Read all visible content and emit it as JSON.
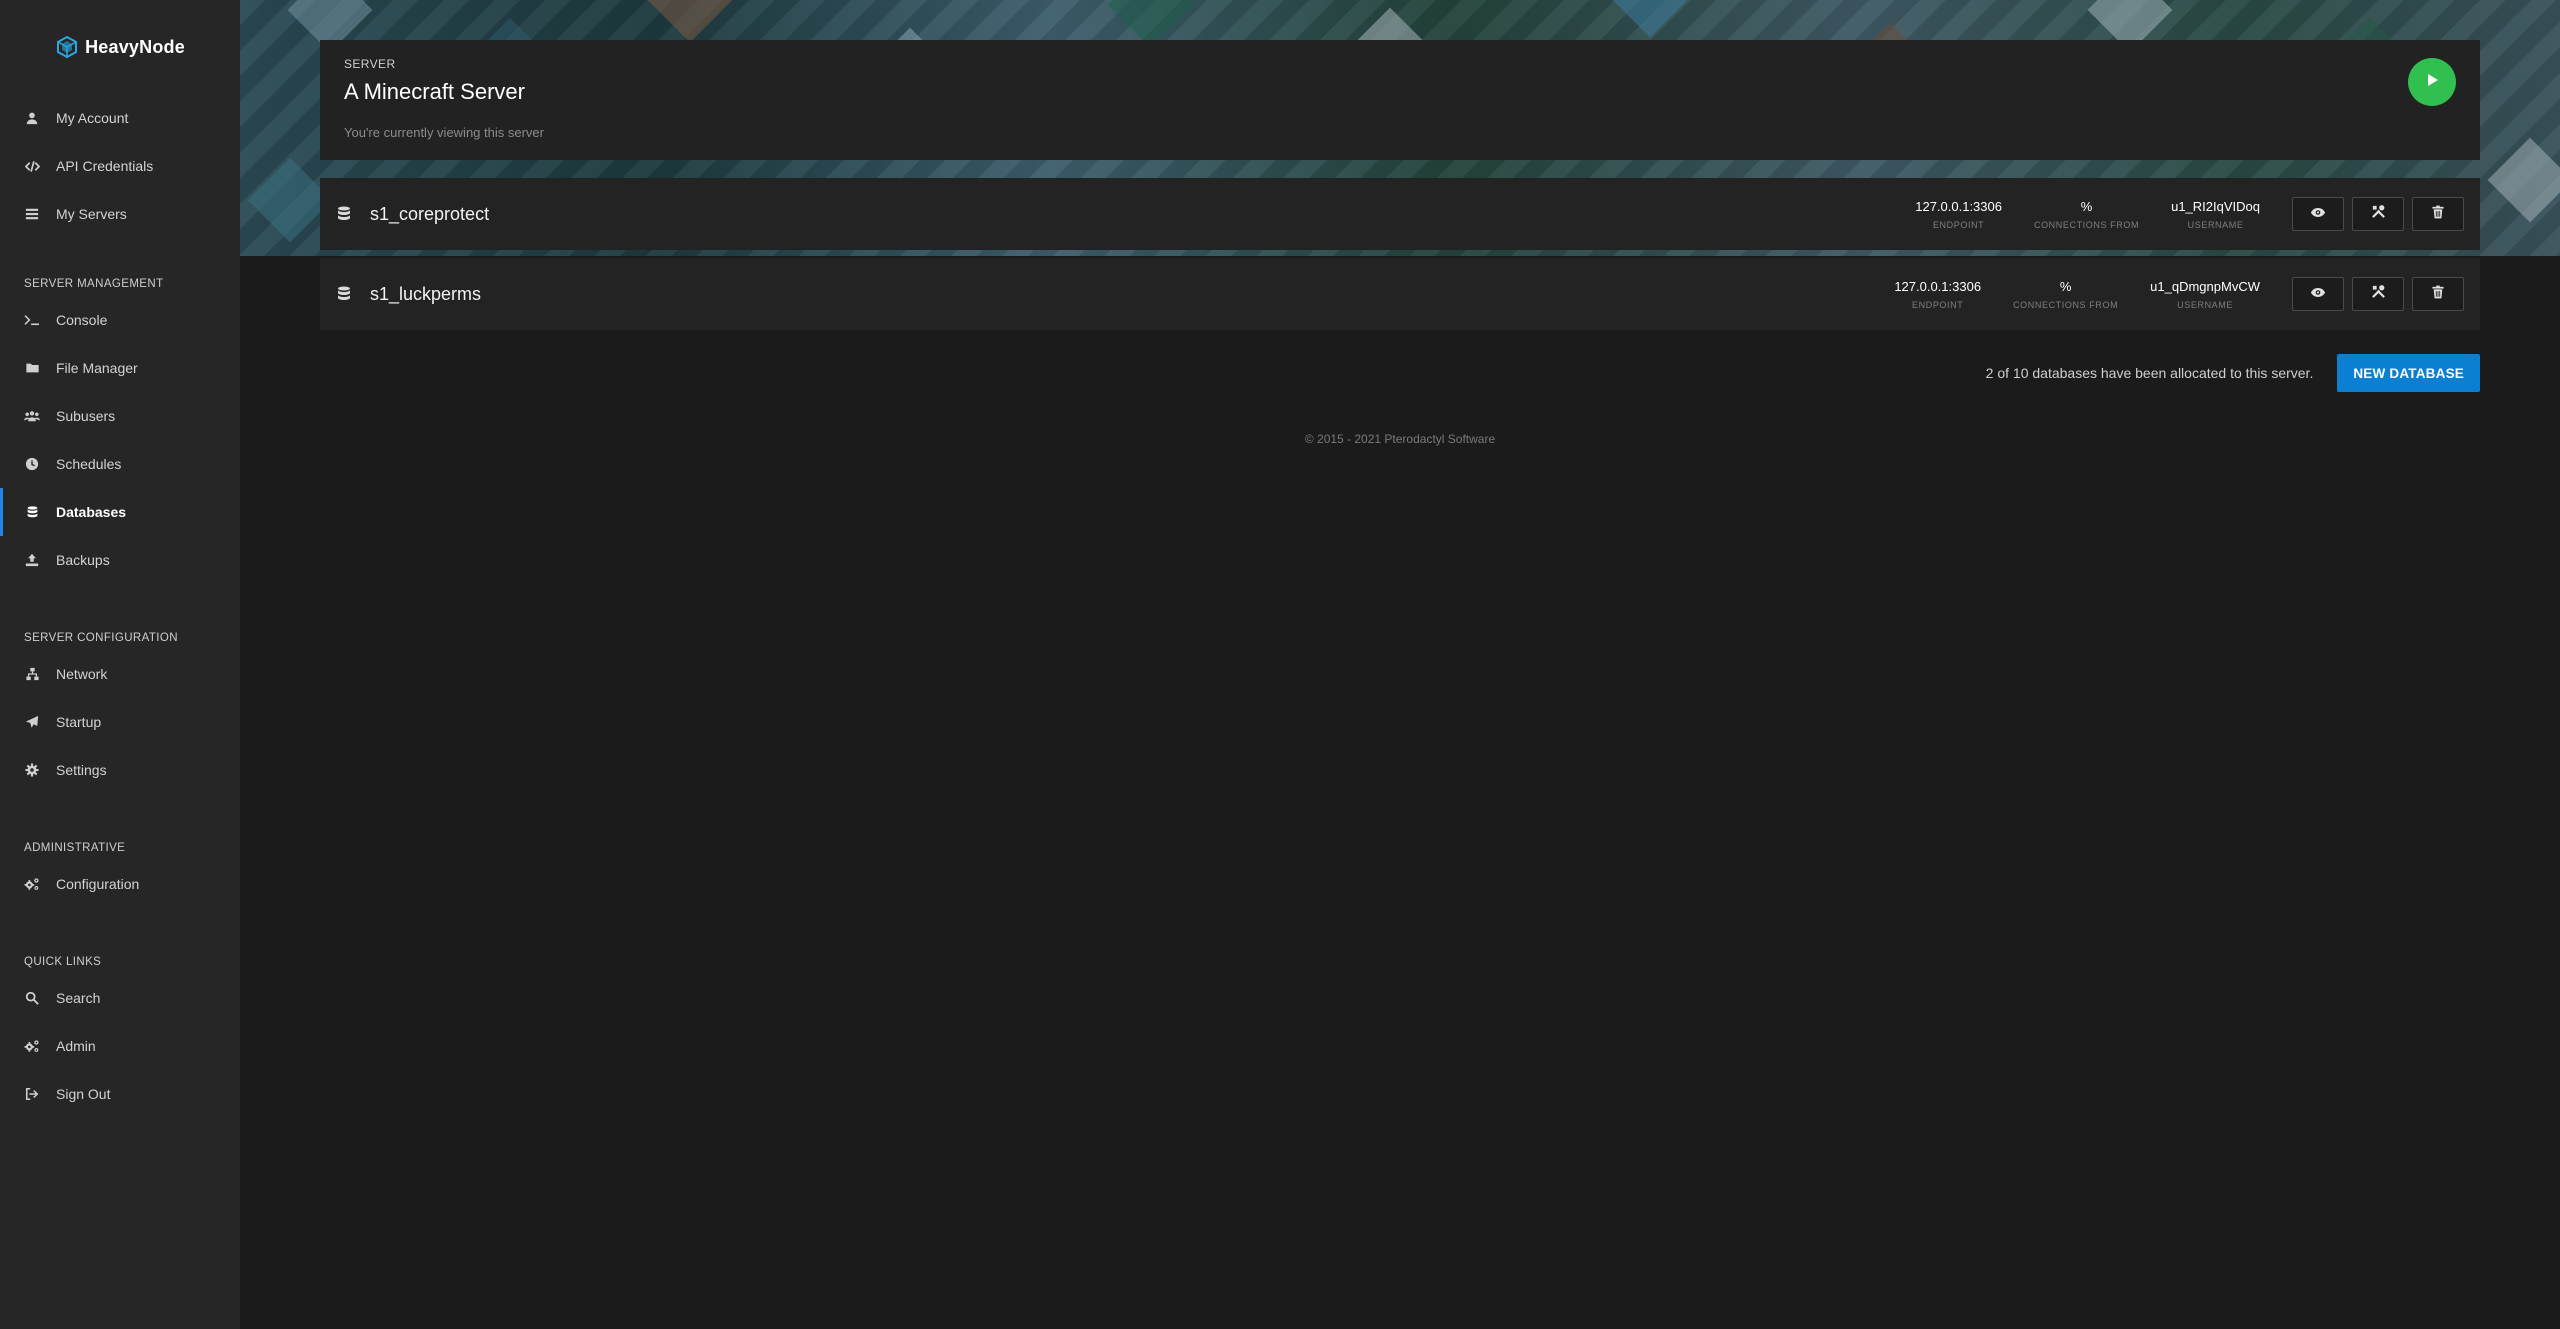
{
  "brand": {
    "name": "HeavyNode"
  },
  "sidebar": {
    "account": [
      {
        "label": "My Account",
        "icon": "user-icon"
      },
      {
        "label": "API Credentials",
        "icon": "code-icon"
      },
      {
        "label": "My Servers",
        "icon": "list-icon"
      }
    ],
    "server_management": {
      "title": "SERVER MANAGEMENT",
      "items": [
        {
          "label": "Console",
          "icon": "terminal-icon"
        },
        {
          "label": "File Manager",
          "icon": "folder-icon"
        },
        {
          "label": "Subusers",
          "icon": "users-icon"
        },
        {
          "label": "Schedules",
          "icon": "clock-icon"
        },
        {
          "label": "Databases",
          "icon": "database-icon",
          "active": true
        },
        {
          "label": "Backups",
          "icon": "upload-icon"
        }
      ]
    },
    "server_configuration": {
      "title": "SERVER CONFIGURATION",
      "items": [
        {
          "label": "Network",
          "icon": "network-icon"
        },
        {
          "label": "Startup",
          "icon": "paper-plane-icon"
        },
        {
          "label": "Settings",
          "icon": "gear-icon"
        }
      ]
    },
    "administrative": {
      "title": "ADMINISTRATIVE",
      "items": [
        {
          "label": "Configuration",
          "icon": "cogs-icon"
        }
      ]
    },
    "quick_links": {
      "title": "QUICK LINKS",
      "items": [
        {
          "label": "Search",
          "icon": "search-icon"
        },
        {
          "label": "Admin",
          "icon": "cogs-icon"
        },
        {
          "label": "Sign Out",
          "icon": "sign-out-icon"
        }
      ]
    }
  },
  "server": {
    "label": "SERVER",
    "name": "A Minecraft Server",
    "subtitle": "You're currently viewing this server"
  },
  "databases": [
    {
      "name": "s1_coreprotect",
      "endpoint": "127.0.0.1:3306",
      "connections_from": "%",
      "username": "u1_RI2IqVIDoq"
    },
    {
      "name": "s1_luckperms",
      "endpoint": "127.0.0.1:3306",
      "connections_from": "%",
      "username": "u1_qDmgnpMvCW"
    }
  ],
  "labels": {
    "endpoint": "ENDPOINT",
    "connections_from": "CONNECTIONS FROM",
    "username": "USERNAME"
  },
  "allocation": {
    "text": "2 of 10 databases have been allocated to this server.",
    "button": "NEW DATABASE"
  },
  "footer": {
    "text": "© 2015 - 2021 Pterodactyl Software"
  },
  "colors": {
    "accent": "#0b7fd1",
    "active_indicator": "#1e88e5",
    "power_button": "#31c04f",
    "background": "#1b1b1b",
    "sidebar": "#262626"
  }
}
